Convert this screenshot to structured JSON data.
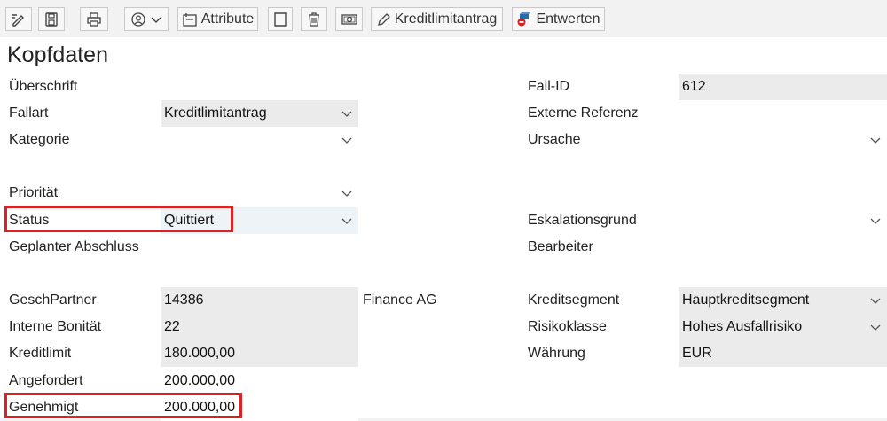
{
  "toolbar": {
    "attribute_label": "Attribute",
    "kreditlimitantrag_label": "Kreditlimitantrag",
    "entwerten_label": "Entwerten",
    "icons": [
      "edit-icon",
      "save-icon",
      "print-icon",
      "user-menu-icon",
      "chevron-down-icon",
      "attribute-icon",
      "note-icon",
      "delete-icon",
      "cash-icon",
      "pencil-icon",
      "invalidate-icon"
    ]
  },
  "header": {
    "title": "Kopfdaten"
  },
  "fields": {
    "ueberschrift": {
      "label": "Überschrift",
      "value": ""
    },
    "fallart": {
      "label": "Fallart",
      "value": "Kreditlimitantrag"
    },
    "kategorie": {
      "label": "Kategorie",
      "value": ""
    },
    "prioritaet": {
      "label": "Priorität",
      "value": ""
    },
    "status": {
      "label": "Status",
      "value": "Quittiert"
    },
    "geplanter_abschluss": {
      "label": "Geplanter Abschluss",
      "value": ""
    },
    "geschpartner": {
      "label": "GeschPartner",
      "value": "14386",
      "name": "Finance AG"
    },
    "interne_bonitaet": {
      "label": "Interne Bonität",
      "value": "22"
    },
    "kreditlimit": {
      "label": "Kreditlimit",
      "value": "180.000,00"
    },
    "angefordert": {
      "label": "Angefordert",
      "value": "200.000,00"
    },
    "genehmigt": {
      "label": "Genehmigt",
      "value": "200.000,00"
    },
    "fall_id": {
      "label": "Fall-ID",
      "value": "612"
    },
    "externe_referenz": {
      "label": "Externe Referenz",
      "value": ""
    },
    "ursache": {
      "label": "Ursache",
      "value": ""
    },
    "eskalationsgrund": {
      "label": "Eskalationsgrund",
      "value": ""
    },
    "bearbeiter": {
      "label": "Bearbeiter",
      "value": ""
    },
    "kreditsegment": {
      "label": "Kreditsegment",
      "value": "Hauptkreditsegment"
    },
    "risikoklasse": {
      "label": "Risikoklasse",
      "value": "Hohes Ausfallrisiko"
    },
    "waehrung": {
      "label": "Währung",
      "value": "EUR"
    }
  },
  "colors": {
    "highlight": "#e02020",
    "readonly_bg": "#ebebeb",
    "accent": "#2a6bb0"
  }
}
